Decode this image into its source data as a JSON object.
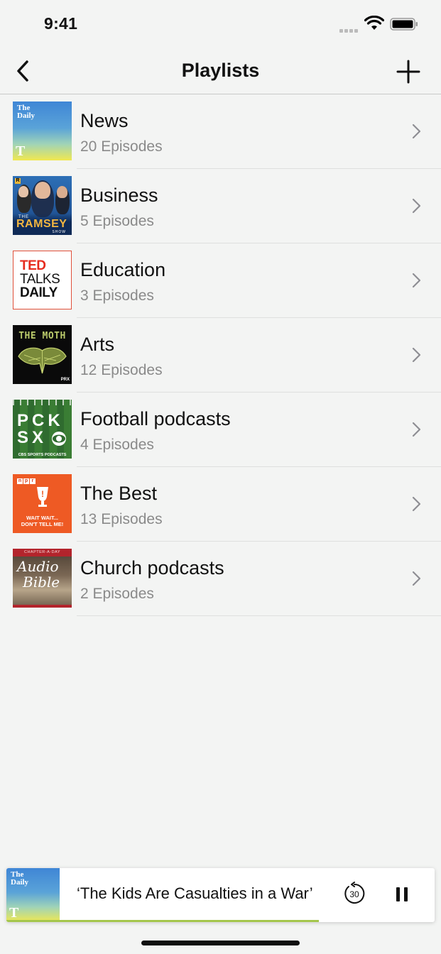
{
  "status_bar": {
    "time": "9:41"
  },
  "nav": {
    "title": "Playlists"
  },
  "playlists": [
    {
      "title": "News",
      "subtitle": "20 Episodes",
      "art": "the-daily-artwork"
    },
    {
      "title": "Business",
      "subtitle": "5 Episodes",
      "art": "ramsey-show-artwork"
    },
    {
      "title": "Education",
      "subtitle": "3 Episodes",
      "art": "ted-talks-daily-artwork"
    },
    {
      "title": "Arts",
      "subtitle": "12 Episodes",
      "art": "the-moth-artwork"
    },
    {
      "title": "Football podcasts",
      "subtitle": "4 Episodes",
      "art": "pick-six-artwork"
    },
    {
      "title": "The Best",
      "subtitle": "13 Episodes",
      "art": "wait-wait-artwork"
    },
    {
      "title": "Church podcasts",
      "subtitle": "2 Episodes",
      "art": "audio-bible-artwork"
    }
  ],
  "artwork_text": {
    "daily": "The Daily",
    "nyt": "T",
    "ramsey_r": "R",
    "ramsey_the": "THE",
    "ramsey_name": "RAMSEY",
    "ramsey_show": "SHOW",
    "ted_1": "TED",
    "ted_2": "TALKS",
    "ted_3": "DAILY",
    "moth_title": "THE MOTH",
    "moth_prx": "PRX",
    "pick_1": "PCK",
    "pick_2": "SX",
    "pick_cbs": "CBS SPORTS PODCASTS",
    "wait_npr": [
      "n",
      "p",
      "r"
    ],
    "wait_text_1": "WAIT WAIT...",
    "wait_text_2": "DON'T TELL ME!",
    "bible_top": "CHAPTER-A-DAY",
    "bible_1": "Audio",
    "bible_2": "Bible"
  },
  "mini_player": {
    "title": "‘The Kids Are Casualties in a War’",
    "skip_label": "30",
    "progress": 0.73,
    "art": "the-daily-artwork"
  },
  "colors": {
    "background": "#f3f4f3",
    "accent_progress": "#a4c64c",
    "subtitle": "#8a8a8a",
    "chevron": "#8e8e93"
  }
}
